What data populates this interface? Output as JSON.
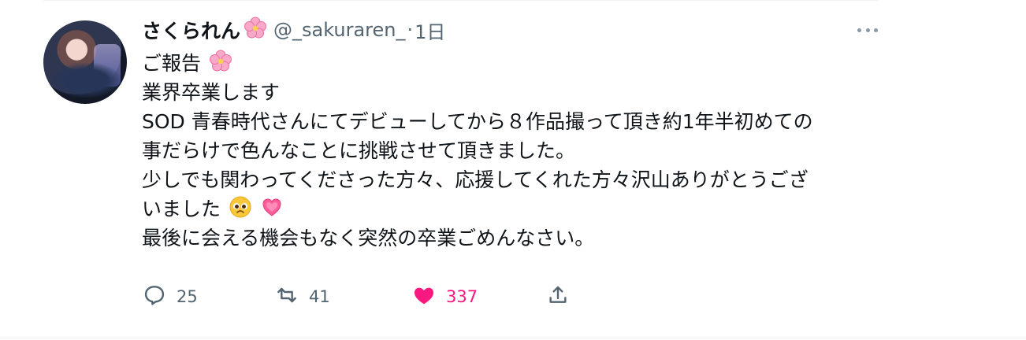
{
  "tweet": {
    "display_name": "さくられん",
    "handle": "@_sakuraren_",
    "separator": "·",
    "time": "1日",
    "lines": [
      "ご報告",
      "業界卒業します",
      "SOD 青春時代さんにてデビューしてから８作品撮って頂き約1年半初めての",
      "事だらけで色んなことに挑戦させて頂きました。",
      "少しでも関わってくださった方々、応援してくれた方々沢山ありがとうござ",
      "いました",
      "最後に会える機会もなく突然の卒業ごめんなさい。"
    ],
    "icons": [
      "cherry-blossom-icon",
      "pleading-face-icon",
      "growing-heart-icon"
    ]
  },
  "actions": {
    "replies": "25",
    "retweets": "41",
    "likes": "337"
  },
  "colors": {
    "text": "#0f1419",
    "secondary": "#536471",
    "like": "#f91880",
    "divider": "#eff3f4"
  }
}
